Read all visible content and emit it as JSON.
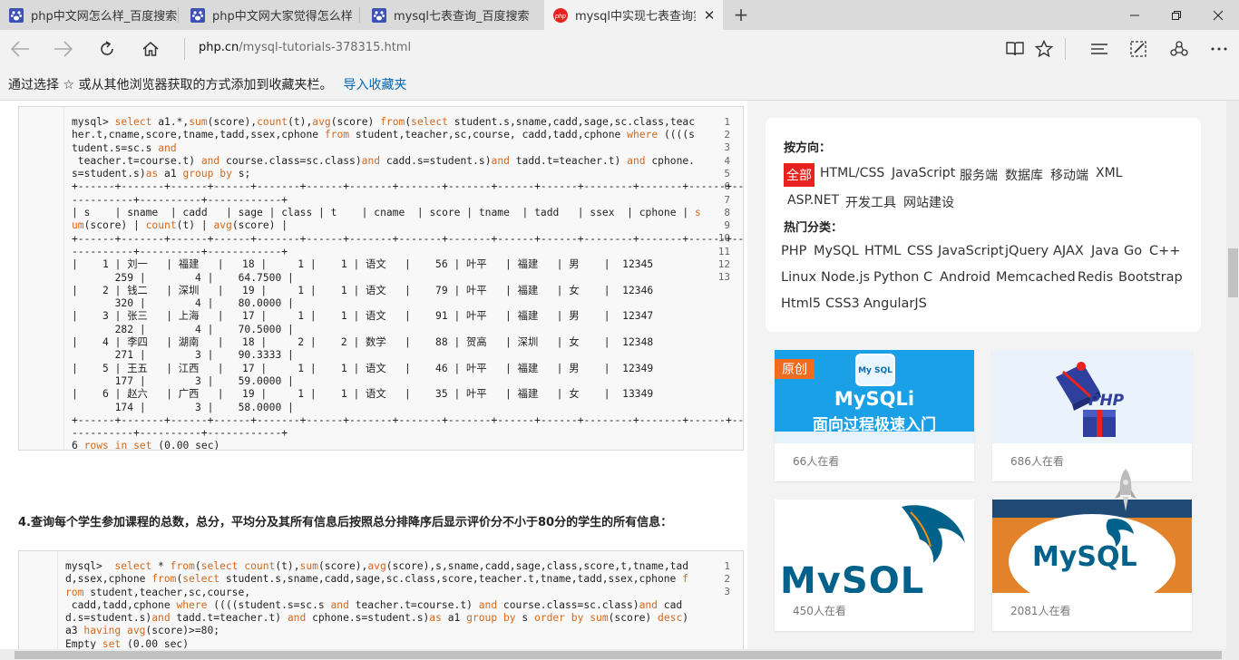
{
  "tabs": [
    {
      "title": "php中文网怎么样_百度搜索",
      "favicon": "baidu-paw-icon"
    },
    {
      "title": "php中文网大家觉得怎么样",
      "favicon": "baidu-paw-icon"
    },
    {
      "title": "mysql七表查询_百度搜索",
      "favicon": "baidu-paw-icon"
    },
    {
      "title": "mysql中实现七表查询实",
      "favicon": "php-cn-icon"
    }
  ],
  "address": {
    "host": "php.cn",
    "path": "/mysql-tutorials-378315.html"
  },
  "favbar": {
    "text": "通过选择 ☆ 或从其他浏览器获取的方式添加到收藏夹栏。",
    "link": "导入收藏夹"
  },
  "code1": {
    "line_numbers": [
      "1",
      "2",
      "3",
      "4",
      "5",
      "6",
      "7",
      "8",
      "9",
      "10",
      "11",
      "12",
      "13"
    ],
    "footer_count": "6",
    "footer_rows": "rows",
    "footer_in": "in",
    "footer_set": "set",
    "footer_time": "(0.00 sec)"
  },
  "heading": "4.查询每个学生参加课程的总数，总分，平均分及其所有信息后按照总分排降序后显示评价分不小于80分的学生的所有信息：",
  "code2": {
    "line_numbers": [
      "1",
      "2",
      "3"
    ]
  },
  "sidebar": {
    "direction_label": "按方向：",
    "directions": [
      "全部",
      "HTML/CSS",
      "JavaScript",
      "服务端",
      "数据库",
      "移动端",
      "XML",
      "ASP.NET",
      "开发工具",
      "网站建设"
    ],
    "hot_label": "热门分类：",
    "hot": [
      "PHP",
      "MySQL",
      "HTML",
      "CSS",
      "JavaScript",
      "jQuery",
      "AJAX",
      "Java",
      "Go",
      "C++",
      "Linux",
      "Node.js",
      "Python",
      "C",
      "Android",
      "Memcached",
      "Redis",
      "Bootstrap",
      "Html5",
      "CSS3",
      "AngularJS"
    ]
  },
  "courses": [
    {
      "badge": "原创",
      "logo": "My SQL",
      "title": "MySQLi",
      "subtitle": "面向过程极速入门",
      "views": "66人在看"
    },
    {
      "logo": "PHP",
      "views": "686人在看"
    },
    {
      "logo": "MySQL",
      "views": "450人在看"
    },
    {
      "logo": "MySQL",
      "views": "2081人在看"
    }
  ],
  "colors": {
    "accent": "#e8231f",
    "link": "#0066b4",
    "keyword": "#d2691e"
  }
}
